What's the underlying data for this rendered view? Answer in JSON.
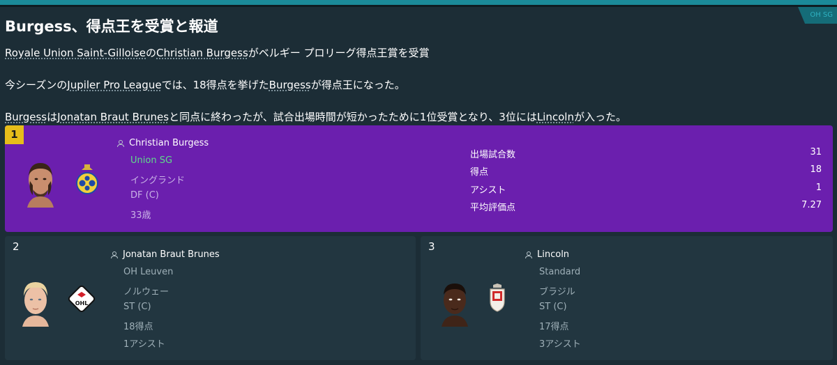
{
  "article": {
    "headline": "Burgess、得点王を受賞と報道",
    "lines": [
      {
        "parts": [
          {
            "text": "Royale Union Saint-Gilloise",
            "link": true
          },
          {
            "text": "の",
            "link": false
          },
          {
            "text": "Christian Burgess",
            "link": true
          },
          {
            "text": "がベルギー プロリーグ得点王賞を受賞",
            "link": false
          }
        ]
      },
      {
        "parts": [
          {
            "text": "今シーズンの",
            "link": false
          },
          {
            "text": "Jupiler Pro League",
            "link": true
          },
          {
            "text": "では、18得点を挙げた",
            "link": false
          },
          {
            "text": "Burgess",
            "link": true
          },
          {
            "text": "が得点王になった。",
            "link": false
          }
        ]
      },
      {
        "parts": [
          {
            "text": "Burgess",
            "link": true
          },
          {
            "text": "は",
            "link": false
          },
          {
            "text": "Jonatan Braut Brunes",
            "link": true
          },
          {
            "text": "と同点に終わったが、試合出場時間が短かったために1位受賞となり、3位には",
            "link": false
          },
          {
            "text": "Lincoln",
            "link": true
          },
          {
            "text": "が入った。",
            "link": false
          }
        ]
      }
    ]
  },
  "winner": {
    "rank": "1",
    "name": "Christian Burgess",
    "club": "Union SG",
    "nationality": "イングランド",
    "position": "DF (C)",
    "age": "33歳",
    "stats": [
      {
        "label": "出場試合数",
        "value": "31"
      },
      {
        "label": "得点",
        "value": "18"
      },
      {
        "label": "アシスト",
        "value": "1"
      },
      {
        "label": "平均評価点",
        "value": "7.27"
      }
    ]
  },
  "runners_up": [
    {
      "rank": "2",
      "name": "Jonatan Braut Brunes",
      "club": "OH Leuven",
      "nationality": "ノルウェー",
      "position": "ST (C)",
      "goals": "18得点",
      "assists": "1アシスト"
    },
    {
      "rank": "3",
      "name": "Lincoln",
      "club": "Standard",
      "nationality": "ブラジル",
      "position": "ST (C)",
      "goals": "17得点",
      "assists": "3アシスト"
    }
  ],
  "colors": {
    "accent": "#1b8a99",
    "winner_card": "#6b1fae",
    "rank_badge": "#e6bd1a",
    "club_highlight": "#57d883"
  },
  "icons": [
    "person-icon",
    "club-crest-union-sg",
    "club-crest-oh-leuven",
    "club-crest-standard"
  ],
  "top_right_tab": "OH SG"
}
